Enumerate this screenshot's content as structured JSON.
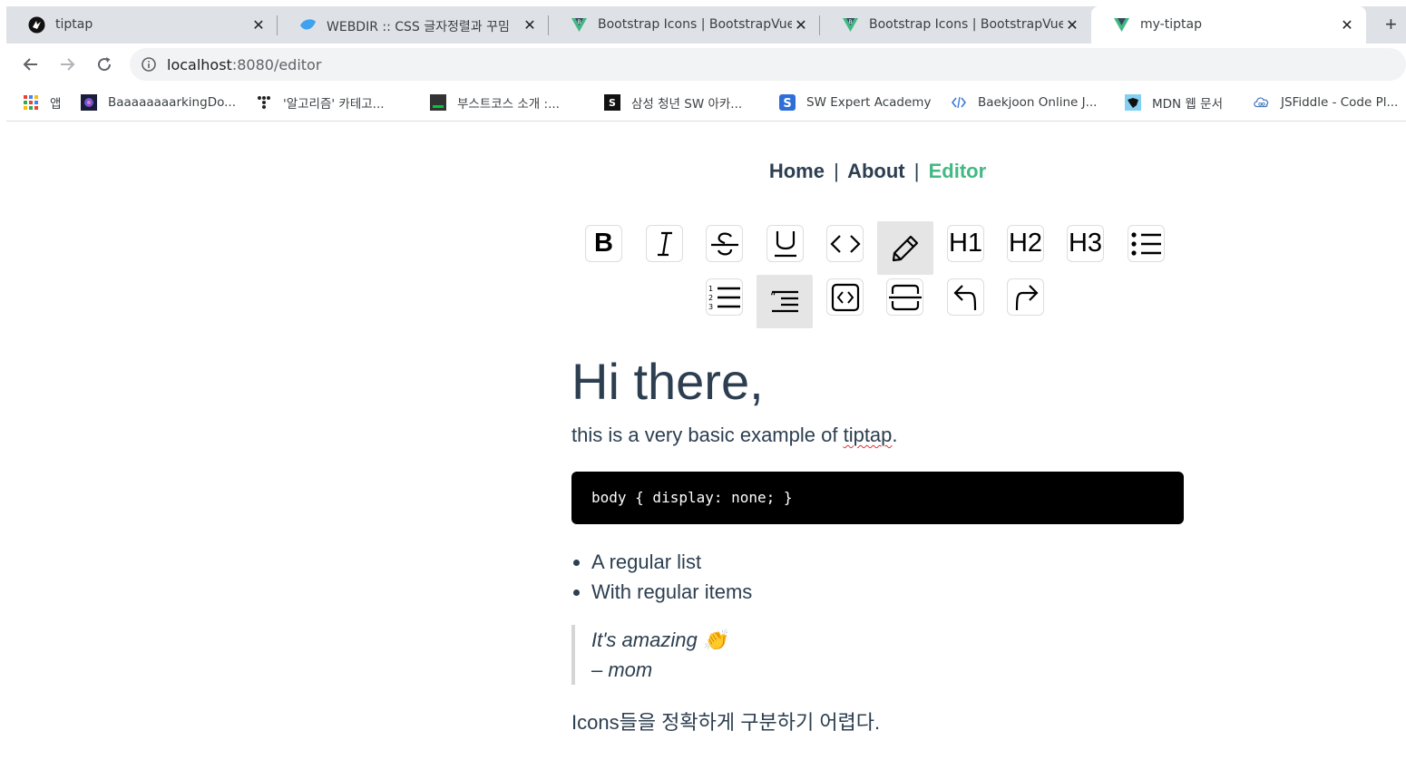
{
  "browser": {
    "tabs": [
      {
        "title": "tiptap",
        "icon": "tiptap-icon"
      },
      {
        "title": "WEBDIR :: CSS 글자정렬과 꾸밈",
        "icon": "webdir-icon"
      },
      {
        "title": "Bootstrap Icons | BootstrapVue",
        "icon": "bootstrapvue-icon"
      },
      {
        "title": "Bootstrap Icons | BootstrapVue",
        "icon": "bootstrapvue-icon"
      },
      {
        "title": "my-tiptap",
        "icon": "vue-icon",
        "active": true
      }
    ],
    "new_tab": "+",
    "url_host": "localhost",
    "url_path": ":8080/editor",
    "bookmarks": [
      {
        "label": "앱",
        "icon": "apps-grid-icon"
      },
      {
        "label": "BaaaaaaaarkingDo...",
        "icon": "barkingdog-icon"
      },
      {
        "label": "'알고리즘' 카테고...",
        "icon": "tistory-icon"
      },
      {
        "label": "부스트코스 소개 :...",
        "icon": "boostcourse-icon"
      },
      {
        "label": "삼성 청년 SW 아카...",
        "icon": "ssafy-icon"
      },
      {
        "label": "SW Expert Academy",
        "icon": "swea-icon"
      },
      {
        "label": "Baekjoon Online J...",
        "icon": "baekjoon-icon"
      },
      {
        "label": "MDN 웹 문서",
        "icon": "mdn-icon"
      },
      {
        "label": "JSFiddle - Code Pl...",
        "icon": "jsfiddle-icon"
      }
    ]
  },
  "page": {
    "nav": {
      "home": "Home",
      "about": "About",
      "editor": "Editor",
      "separator": "|"
    },
    "menubar": {
      "bold": "B",
      "italic": "I",
      "h1": "H1",
      "h2": "H2",
      "h3": "H3"
    },
    "content": {
      "heading": "Hi there,",
      "para_before": "this is a very basic example of ",
      "para_link": "tiptap",
      "para_after": ".",
      "code": "body { display: none; }",
      "list": [
        "A regular list",
        "With regular items"
      ],
      "quote_line1": "It's amazing 👏",
      "quote_line2": "– mom",
      "last": "Icons들을 정확하게 구분하기 어렵다."
    }
  },
  "colors": {
    "accent": "#42b983",
    "text": "#2c3e50",
    "code_bg": "#000000"
  }
}
